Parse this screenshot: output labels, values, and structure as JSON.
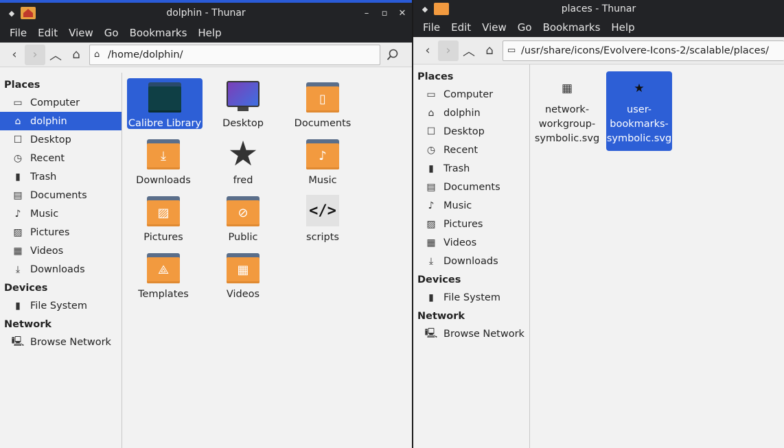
{
  "left": {
    "title": "dolphin - Thunar",
    "menu": [
      "File",
      "Edit",
      "View",
      "Go",
      "Bookmarks",
      "Help"
    ],
    "location": "/home/dolphin/",
    "sidebar": {
      "places_label": "Places",
      "places": [
        "Computer",
        "dolphin",
        "Desktop",
        "Recent",
        "Trash",
        "Documents",
        "Music",
        "Pictures",
        "Videos",
        "Downloads"
      ],
      "devices_label": "Devices",
      "devices": [
        "File System"
      ],
      "network_label": "Network",
      "network": [
        "Browse Network"
      ]
    },
    "items": [
      "Calibre Library",
      "Desktop",
      "Documents",
      "Downloads",
      "fred",
      "Music",
      "Pictures",
      "Public",
      "scripts",
      "Templates",
      "Videos"
    ]
  },
  "right": {
    "title": "places - Thunar",
    "menu": [
      "File",
      "Edit",
      "View",
      "Go",
      "Bookmarks",
      "Help"
    ],
    "location": "/usr/share/icons/Evolvere-Icons-2/scalable/places/",
    "sidebar": {
      "places_label": "Places",
      "places": [
        "Computer",
        "dolphin",
        "Desktop",
        "Recent",
        "Trash",
        "Documents",
        "Music",
        "Pictures",
        "Videos",
        "Downloads"
      ],
      "devices_label": "Devices",
      "devices": [
        "File System"
      ],
      "network_label": "Network",
      "network": [
        "Browse Network"
      ]
    },
    "files": [
      {
        "line1": "network-",
        "line2": "workgroup-",
        "line3": "symbolic.svg"
      },
      {
        "line1": "user-",
        "line2": "bookmarks-",
        "line3": "symbolic.svg"
      }
    ]
  },
  "icons": {
    "places": [
      "monitor-icon",
      "home-icon",
      "desktop-icon",
      "clock-icon",
      "trash-icon",
      "document-icon",
      "music-icon",
      "pictures-icon",
      "videos-icon",
      "download-icon"
    ],
    "devices": [
      "drive-icon"
    ],
    "network": [
      "network-icon"
    ]
  },
  "colors": {
    "selection": "#2d5fd6",
    "folder": "#f29a3f",
    "titlebar": "#222326",
    "accent_border": "#2a5bd7"
  }
}
